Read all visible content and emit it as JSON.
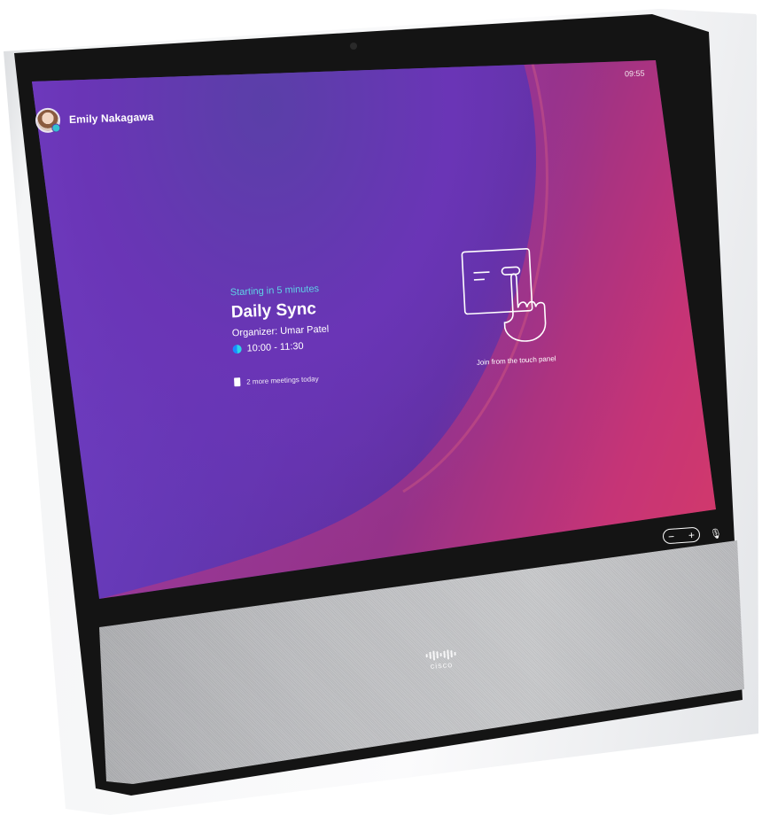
{
  "device": {
    "brand_text": "cisco",
    "accent_colors": {
      "starting_text": "#5fd1e6",
      "screen_purple": "#6a35b6",
      "screen_red": "#e8474f"
    }
  },
  "header": {
    "user_name": "Emily Nakagawa",
    "clock": "09:55"
  },
  "meeting": {
    "status": "Starting in 5 minutes",
    "title": "Daily Sync",
    "organizer": "Organizer: Umar Patel",
    "time_range": "10:00 - 11:30",
    "more_meetings": "2 more meetings today"
  },
  "touch_hint": {
    "label": "Join from the touch panel",
    "icon": "touch-panel-icon"
  },
  "controls": {
    "volume_minus": "−",
    "volume_plus": "+",
    "mic_icon": "microphone-icon"
  }
}
